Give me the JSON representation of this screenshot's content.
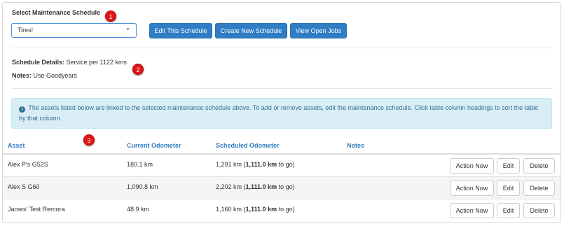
{
  "select_label": "Select Maintenance Schedule",
  "schedule_select": {
    "value": "Tires!"
  },
  "buttons": {
    "edit_schedule": "Edit This Schedule",
    "create_schedule": "Create New Schedule",
    "view_jobs": "View Open Jobs"
  },
  "badges": [
    "1",
    "2",
    "3"
  ],
  "details": {
    "schedule_label": "Schedule Details:",
    "schedule_value": "Service per 1122 kms",
    "notes_label": "Notes:",
    "notes_value": "Use Goodyears"
  },
  "info_text": "The assets listed below are linked to the selected maintenance schedule above. To add or remove assets, edit the maintenance schedule. Click table column headings to sort the table by that column.",
  "table": {
    "headers": {
      "asset": "Asset",
      "current": "Current Odometer",
      "scheduled": "Scheduled Odometer",
      "notes": "Notes"
    },
    "rows": [
      {
        "asset": "Alex P's G52S",
        "current": "180.1 km",
        "sched_pre": "1,291 km (",
        "sched_bold": "1,111.0 km",
        "sched_post": " to go)",
        "notes": ""
      },
      {
        "asset": "Alex S G60",
        "current": "1,090.8 km",
        "sched_pre": "2,202 km (",
        "sched_bold": "1,111.0 km",
        "sched_post": " to go)",
        "notes": ""
      },
      {
        "asset": "James' Test Remora",
        "current": "48.9 km",
        "sched_pre": "1,160 km (",
        "sched_bold": "1,111.0 km",
        "sched_post": " to go)",
        "notes": ""
      }
    ],
    "row_buttons": {
      "action": "Action Now",
      "edit": "Edit",
      "delete": "Delete"
    }
  }
}
